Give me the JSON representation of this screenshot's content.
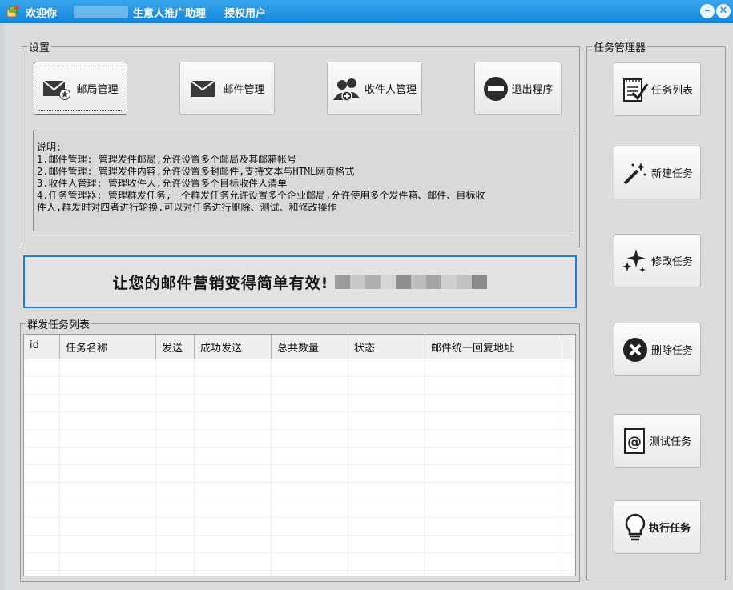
{
  "window": {
    "title_prefix": "欢迎你",
    "title_app": "生意人推广助理",
    "title_license": "授权用户",
    "minimize_glyph": "–",
    "close_glyph": "✕"
  },
  "settings": {
    "legend": "设置",
    "buttons": [
      {
        "label": "邮局管理",
        "icon": "mail-star-icon"
      },
      {
        "label": "邮件管理",
        "icon": "envelope-icon"
      },
      {
        "label": "收件人管理",
        "icon": "add-user-icon"
      },
      {
        "label": "退出程序",
        "icon": "minus-circle-icon"
      }
    ],
    "description": [
      "说明:",
      "1.邮件管理: 管理发件邮局,允许设置多个邮局及其邮箱帐号",
      "2.邮件管理: 管理发件内容,允许设置多封邮件,支持文本与HTML网页格式",
      "3.收件人管理: 管理收件人,允许设置多个目标收件人清单",
      "4.任务管理器: 管理群发任务,一个群发任务允许设置多个企业邮局,允许使用多个发件箱、邮件、目标收",
      "件人,群发时对四者进行轮换.可以对任务进行删除、测试、和修改操作"
    ]
  },
  "banner": {
    "text": "让您的邮件营销变得简单有效!"
  },
  "task_list": {
    "legend": "群发任务列表",
    "columns": [
      "id",
      "任务名称",
      "发送",
      "成功发送",
      "总共数量",
      "状态",
      "邮件统一回复地址"
    ],
    "rows": []
  },
  "task_manager": {
    "legend": "任务管理器",
    "buttons": [
      {
        "label": "任务列表",
        "icon": "checklist-icon"
      },
      {
        "label": "新建任务",
        "icon": "magic-wand-icon"
      },
      {
        "label": "修改任务",
        "icon": "sparkle-icon"
      },
      {
        "label": "删除任务",
        "icon": "x-circle-icon"
      },
      {
        "label": "测试任务",
        "icon": "at-sign-icon"
      },
      {
        "label": "执行任务",
        "icon": "lightbulb-icon"
      }
    ]
  },
  "colors": {
    "titlebar": "#1b8ce0",
    "banner_border": "#1b7fd4",
    "background": "#dcdcdc"
  }
}
